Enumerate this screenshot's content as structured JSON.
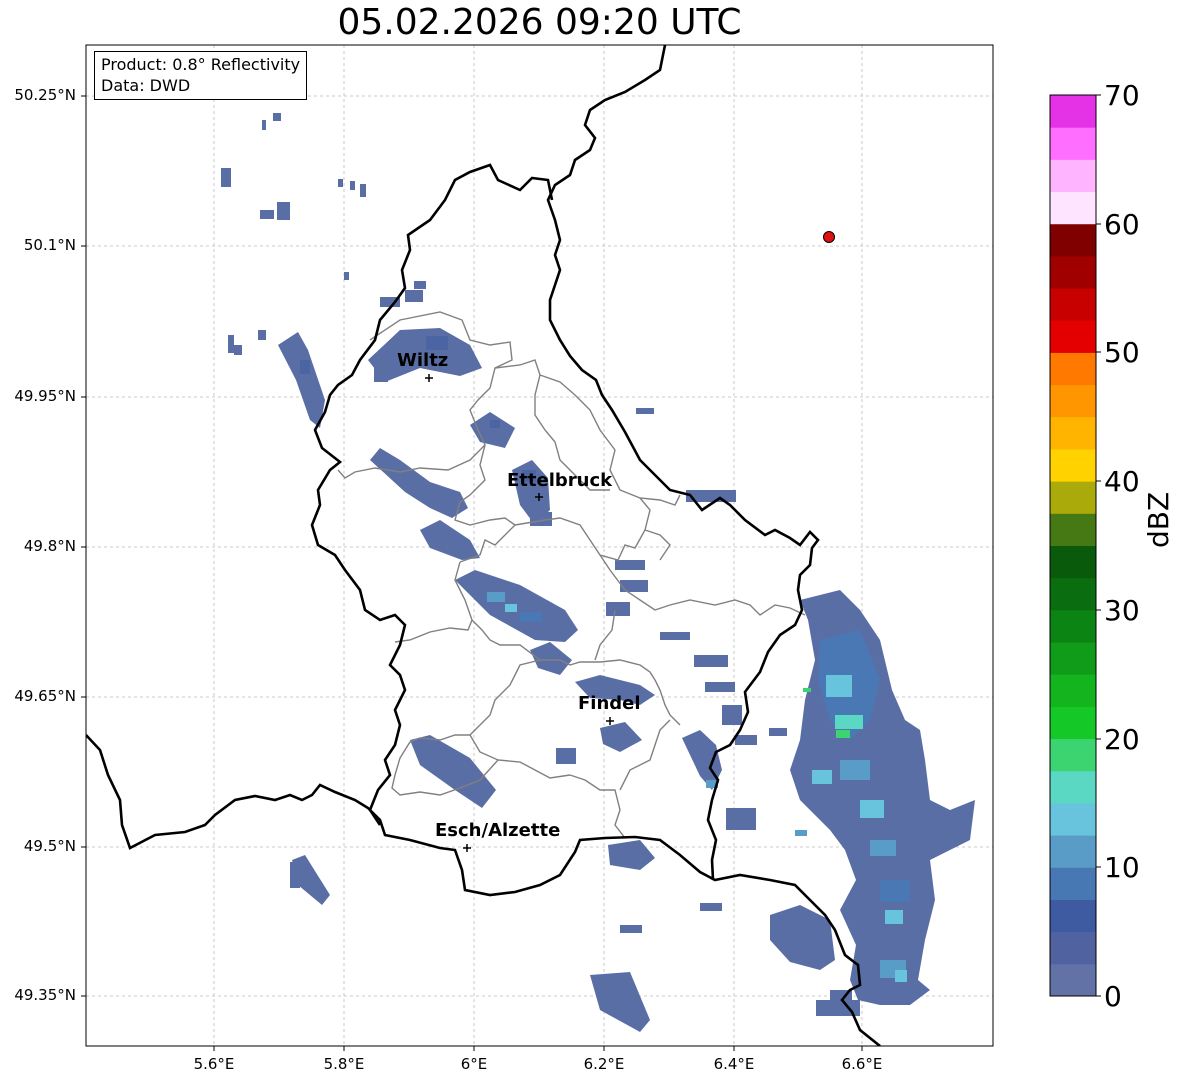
{
  "title": "05.02.2026 09:20 UTC",
  "info_box": {
    "product": "Product: 0.8° Reflectivity",
    "data_source": "Data: DWD"
  },
  "latitude_ticks": [
    "50.25°N",
    "50.1°N",
    "49.95°N",
    "49.8°N",
    "49.65°N",
    "49.5°N",
    "49.35°N"
  ],
  "longitude_ticks": [
    "5.6°E",
    "5.8°E",
    "6°E",
    "6.2°E",
    "6.4°E",
    "6.6°E"
  ],
  "cities": [
    "Wiltz",
    "Ettelbruck",
    "Findel",
    "Esch/Alzette"
  ],
  "colorbar": {
    "label": "dBZ",
    "ticks": [
      "0",
      "10",
      "20",
      "30",
      "40",
      "50",
      "60",
      "70"
    ],
    "colors": [
      "#6272a6",
      "#5062a0",
      "#3e5aa0",
      "#4878b4",
      "#5a9cc8",
      "#68c4dc",
      "#5ad8c4",
      "#3cd470",
      "#14c828",
      "#14b41e",
      "#109c18",
      "#0c8414",
      "#0a6e10",
      "#0a5a0c",
      "#467814",
      "#aaaa0a",
      "#ffd200",
      "#ffb400",
      "#ff9600",
      "#ff7800",
      "#e40000",
      "#c80000",
      "#a00000",
      "#800000",
      "#ffe4ff",
      "#ffb4ff",
      "#ff6eff",
      "#e632e6"
    ]
  },
  "marker_color": "#e01010",
  "land_colors": {
    "border": "#000000",
    "canton": "#808080",
    "grid": "#bbbbbb"
  }
}
